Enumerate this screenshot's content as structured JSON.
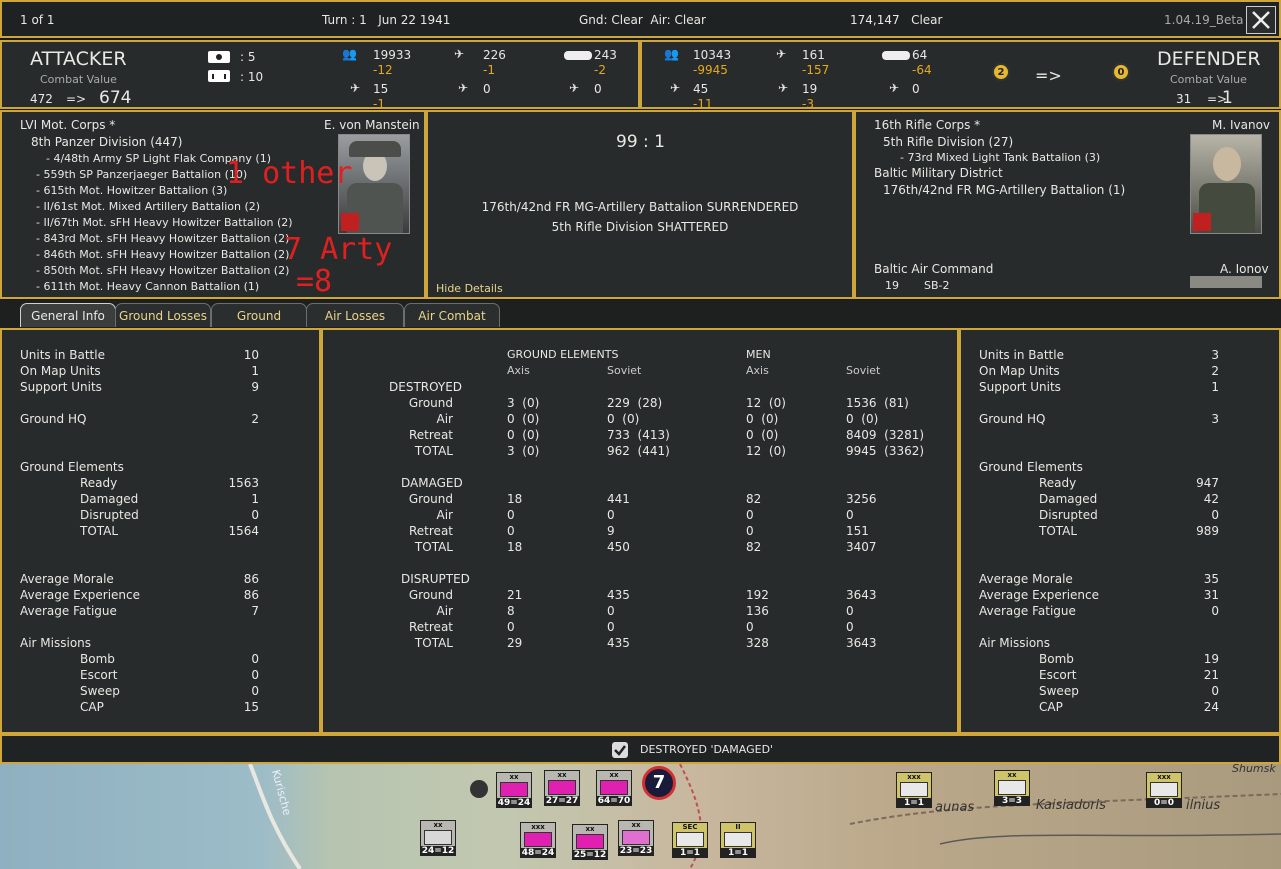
{
  "topbar": {
    "pages": "1 of 1",
    "turn": "Turn : 1   Jun 22 1941",
    "weather": "Gnd: Clear  Air: Clear",
    "location": "174,147   Clear",
    "version": "1.04.19_Beta"
  },
  "attacker": {
    "title": "ATTACKER",
    "cv_label": "Combat Value",
    "cv_from": "472",
    "arrow": "=>",
    "cv_to": "674",
    "flag1": ": 5",
    "flag2": ": 10",
    "men": "19933",
    "men_loss": "-12",
    "fighters": "226",
    "fighters_loss": "-1",
    "tanks": "243",
    "tanks_loss": "-2",
    "bombers": "15",
    "bombers_loss": "-1",
    "transport": "0",
    "recon": "0"
  },
  "defender": {
    "title": "DEFENDER",
    "cv_label": "Combat Value",
    "cv_from": "31",
    "arrow": "=>",
    "cv_to": "1",
    "men": "10343",
    "men_loss": "-9945",
    "fighters": "161",
    "fighters_loss": "-157",
    "tanks": "64",
    "tanks_loss": "-64",
    "bombers": "45",
    "bombers_loss": "-11",
    "transport": "19",
    "transport_loss": "-3",
    "recon": "0",
    "badge_from": "2",
    "badge_arrow": "=>",
    "badge_to": "0"
  },
  "att_units": {
    "corps": "LVI Mot. Corps *",
    "leader": "E. von Manstein",
    "division": "8th Panzer Division (447)",
    "items": [
      "- 4/48th Army SP Light Flak Company (1)",
      "- 559th SP Panzerjaeger Battalion (10)",
      "- 615th Mot. Howitzer Battalion (3)",
      "- II/61st Mot. Mixed Artillery Battalion (2)",
      "- II/67th Mot. sFH Heavy Howitzer Battalion (2)",
      "- 843rd Mot. sFH Heavy Howitzer Battalion (2)",
      "- 846th Mot. sFH Heavy Howitzer Battalion (2)",
      "- 850th Mot. sFH Heavy Howitzer Battalion (2)",
      "- 611th Mot. Heavy Cannon Battalion (1)"
    ],
    "annotation1": "1 other",
    "annotation2": "7 Arty",
    "annotation3": "=8"
  },
  "result": {
    "ratio": "99 : 1",
    "line1": "176th/42nd FR MG-Artillery Battalion SURRENDERED",
    "line2": "5th Rifle Division SHATTERED",
    "hide": "Hide Details"
  },
  "def_units": {
    "corps": "16th Rifle Corps *",
    "leader": "M. Ivanov",
    "division": "5th Rifle Division (27)",
    "sub": "- 73rd Mixed Light Tank Battalion (3)",
    "district": "Baltic Military District",
    "district_unit": "176th/42nd FR MG-Artillery Battalion (1)",
    "air_cmd": "Baltic Air Command",
    "air_leader": "A. Ionov",
    "air_count": "19",
    "air_type": "SB-2"
  },
  "tabs": [
    "General Info",
    "Ground Losses",
    "Ground Combat",
    "Air Losses",
    "Air Combat"
  ],
  "left_stats": {
    "units_in_battle": [
      "Units in Battle",
      "10"
    ],
    "on_map": [
      "On Map Units",
      "1"
    ],
    "support": [
      "Support Units",
      "9"
    ],
    "hq": [
      "Ground HQ",
      "2"
    ],
    "ge": "Ground Elements",
    "ready": [
      "Ready",
      "1563"
    ],
    "damaged": [
      "Damaged",
      "1"
    ],
    "disrupted": [
      "Disrupted",
      "0"
    ],
    "total": [
      "TOTAL",
      "1564"
    ],
    "morale": [
      "Average Morale",
      "86"
    ],
    "exp": [
      "Average Experience",
      "86"
    ],
    "fatigue": [
      "Average Fatigue",
      "7"
    ],
    "air": "Air Missions",
    "bomb": [
      "Bomb",
      "0"
    ],
    "escort": [
      "Escort",
      "0"
    ],
    "sweep": [
      "Sweep",
      "0"
    ],
    "cap": [
      "CAP",
      "15"
    ]
  },
  "right_stats": {
    "units_in_battle": [
      "Units in Battle",
      "3"
    ],
    "on_map": [
      "On Map Units",
      "2"
    ],
    "support": [
      "Support Units",
      "1"
    ],
    "hq": [
      "Ground HQ",
      "3"
    ],
    "ge": "Ground Elements",
    "ready": [
      "Ready",
      "947"
    ],
    "damaged": [
      "Damaged",
      "42"
    ],
    "disrupted": [
      "Disrupted",
      "0"
    ],
    "total": [
      "TOTAL",
      "989"
    ],
    "morale": [
      "Average Morale",
      "35"
    ],
    "exp": [
      "Average Experience",
      "31"
    ],
    "fatigue": [
      "Average Fatigue",
      "0"
    ],
    "air": "Air Missions",
    "bomb": [
      "Bomb",
      "19"
    ],
    "escort": [
      "Escort",
      "21"
    ],
    "sweep": [
      "Sweep",
      "0"
    ],
    "cap": [
      "CAP",
      "24"
    ]
  },
  "losses": {
    "h_ge": "GROUND ELEMENTS",
    "h_men": "MEN",
    "axis": "Axis",
    "soviet": "Soviet",
    "sections": [
      {
        "title": "DESTROYED",
        "rows": [
          [
            "Ground",
            "3  (0)",
            "229  (28)",
            "12  (0)",
            "1536  (81)"
          ],
          [
            "Air",
            "0  (0)",
            "0  (0)",
            "0  (0)",
            "0  (0)"
          ],
          [
            "Retreat",
            "0  (0)",
            "733  (413)",
            "0  (0)",
            "8409  (3281)"
          ],
          [
            "TOTAL",
            "3  (0)",
            "962  (441)",
            "12  (0)",
            "9945  (3362)"
          ]
        ]
      },
      {
        "title": "DAMAGED",
        "rows": [
          [
            "Ground",
            "18",
            "441",
            "82",
            "3256"
          ],
          [
            "Air",
            "0",
            "0",
            "0",
            "0"
          ],
          [
            "Retreat",
            "0",
            "9",
            "0",
            "151"
          ],
          [
            "TOTAL",
            "18",
            "450",
            "82",
            "3407"
          ]
        ]
      },
      {
        "title": "DISRUPTED",
        "rows": [
          [
            "Ground",
            "21",
            "435",
            "192",
            "3643"
          ],
          [
            "Air",
            "8",
            "0",
            "136",
            "0"
          ],
          [
            "Retreat",
            "0",
            "0",
            "0",
            "0"
          ],
          [
            "TOTAL",
            "29",
            "435",
            "328",
            "3643"
          ]
        ]
      }
    ]
  },
  "footer": {
    "checkbox_label": "DESTROYED 'DAMAGED'"
  },
  "map": {
    "towns": [
      "aunas",
      "Kaisiadoris",
      "ilnius",
      "Kurische",
      "Shumsk"
    ],
    "counters": [
      {
        "label": "49=24",
        "top": "xx",
        "color": "#e020b0"
      },
      {
        "label": "27=27",
        "top": "xx",
        "color": "#e020b0"
      },
      {
        "label": "64=70",
        "top": "xx",
        "color": "#e020b0"
      },
      {
        "label": "24=12",
        "top": "xx",
        "color": "#d8d8d8"
      },
      {
        "label": "48=24",
        "top": "xxx",
        "color": "#e020b0"
      },
      {
        "label": "25=12",
        "top": "xx",
        "color": "#e020b0"
      },
      {
        "label": "23=23",
        "top": "xx",
        "color": "#e070d0"
      },
      {
        "label": "1=1",
        "top": "SEC",
        "color": "#e8e8e8"
      },
      {
        "label": "1=1",
        "top": "II",
        "color": "#e8e8e8"
      },
      {
        "label": "1=1",
        "top": "xxx",
        "color": "#e8e8e8"
      },
      {
        "label": "3=3",
        "top": "xx",
        "color": "#e8e8e8"
      },
      {
        "label": "0=0",
        "top": "xxx",
        "color": "#e8e8e8"
      }
    ],
    "turn_marker": "7"
  }
}
